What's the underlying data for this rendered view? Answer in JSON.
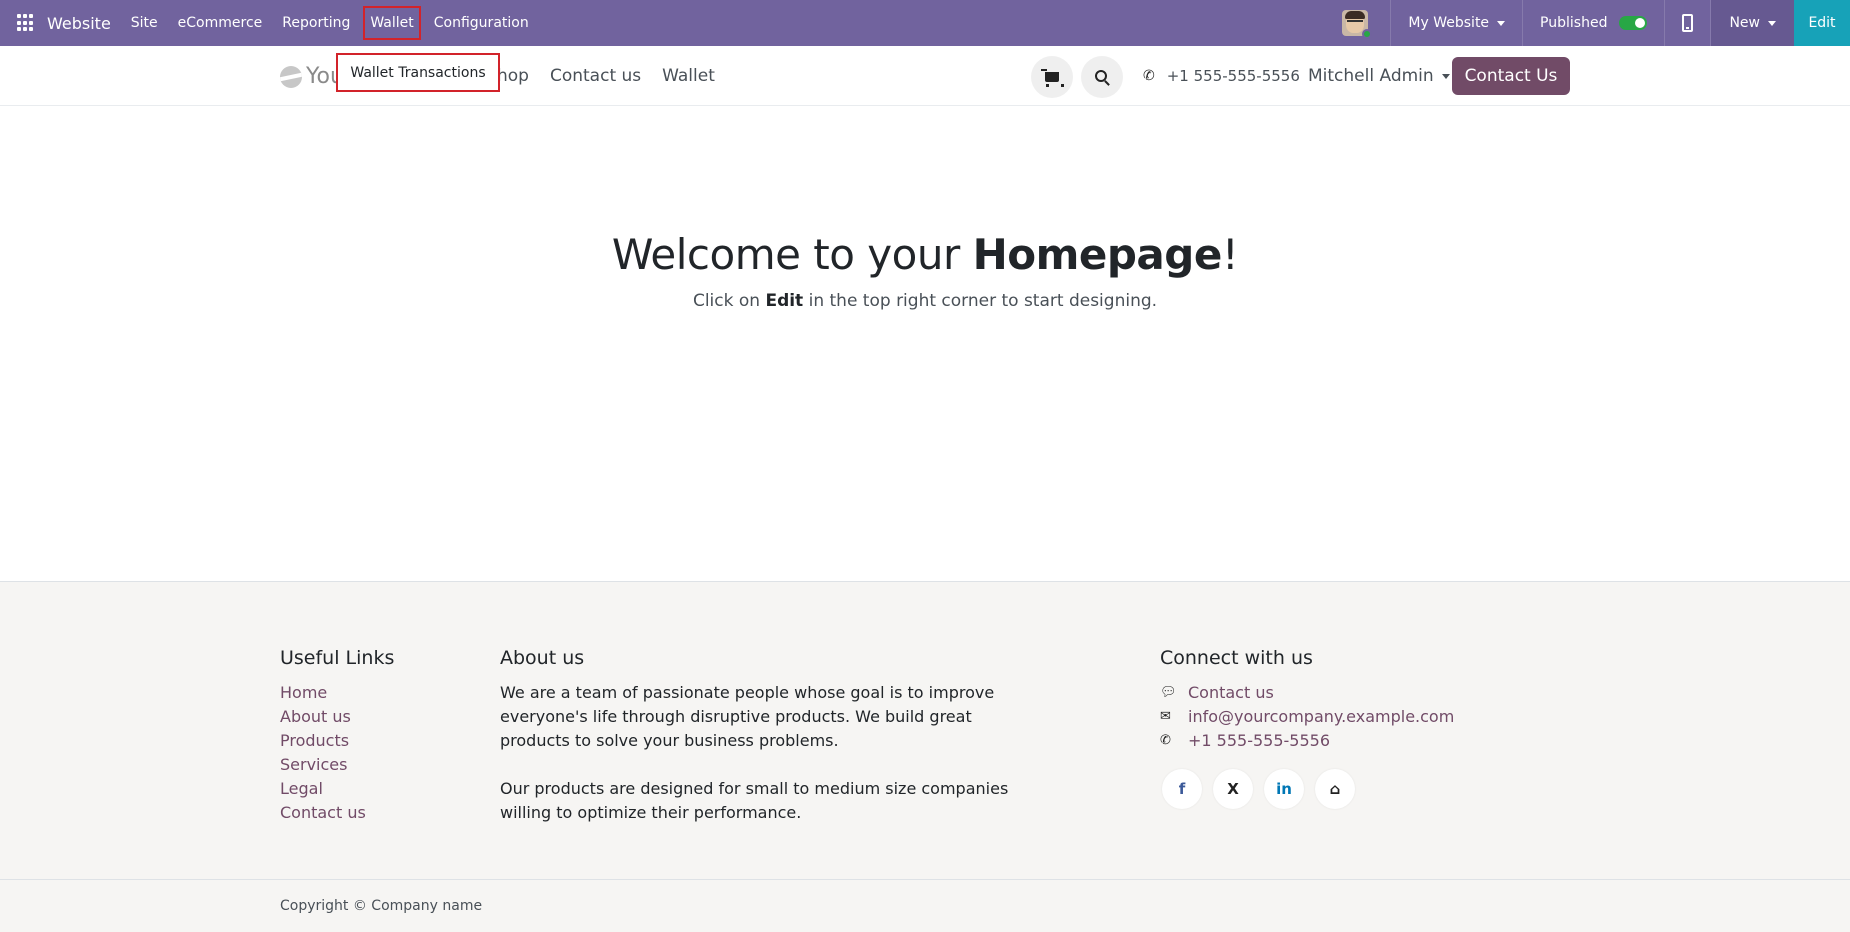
{
  "topbar": {
    "app_name": "Website",
    "menu": [
      "Site",
      "eCommerce",
      "Reporting",
      "Wallet",
      "Configuration"
    ],
    "my_website": "My Website",
    "published": "Published",
    "new": "New",
    "edit": "Edit"
  },
  "dropdown": {
    "item": "Wallet Transactions"
  },
  "header": {
    "logo_text": "You",
    "nav": [
      "hop",
      "Contact us",
      "Wallet"
    ],
    "phone": "+1 555-555-5556",
    "user": "Mitchell Admin",
    "contact_button": "Contact Us"
  },
  "hero": {
    "title_pre": "Welcome to your ",
    "title_bold": "Homepage",
    "title_post": "!",
    "sub_pre": "Click on ",
    "sub_bold": "Edit",
    "sub_post": " in the top right corner to start designing."
  },
  "footer": {
    "useful_links_title": "Useful Links",
    "useful_links": [
      "Home",
      "About us",
      "Products",
      "Services",
      "Legal",
      "Contact us"
    ],
    "about_title": "About us",
    "about_p1": "We are a team of passionate people whose goal is to improve everyone's life through disruptive products. We build great products to solve your business problems.",
    "about_p2": "Our products are designed for small to medium size companies willing to optimize their performance.",
    "connect_title": "Connect with us",
    "connect_contact": "Contact us",
    "connect_email": "info@yourcompany.example.com",
    "connect_phone": "+1 555-555-5556",
    "socials": [
      {
        "icon": "facebook-icon",
        "glyph": "f",
        "color": "#3b5998"
      },
      {
        "icon": "x-icon",
        "glyph": "𝕏",
        "color": "#222222"
      },
      {
        "icon": "linkedin-icon",
        "glyph": "in",
        "color": "#0077b5"
      },
      {
        "icon": "home-icon",
        "glyph": "⌂",
        "color": "#222222"
      }
    ],
    "copyright": "Copyright © Company name"
  },
  "colors": {
    "topbar": "#71639e",
    "edit_button": "#17a2b8",
    "primary": "#714b67",
    "highlight_box": "#d2232a"
  }
}
